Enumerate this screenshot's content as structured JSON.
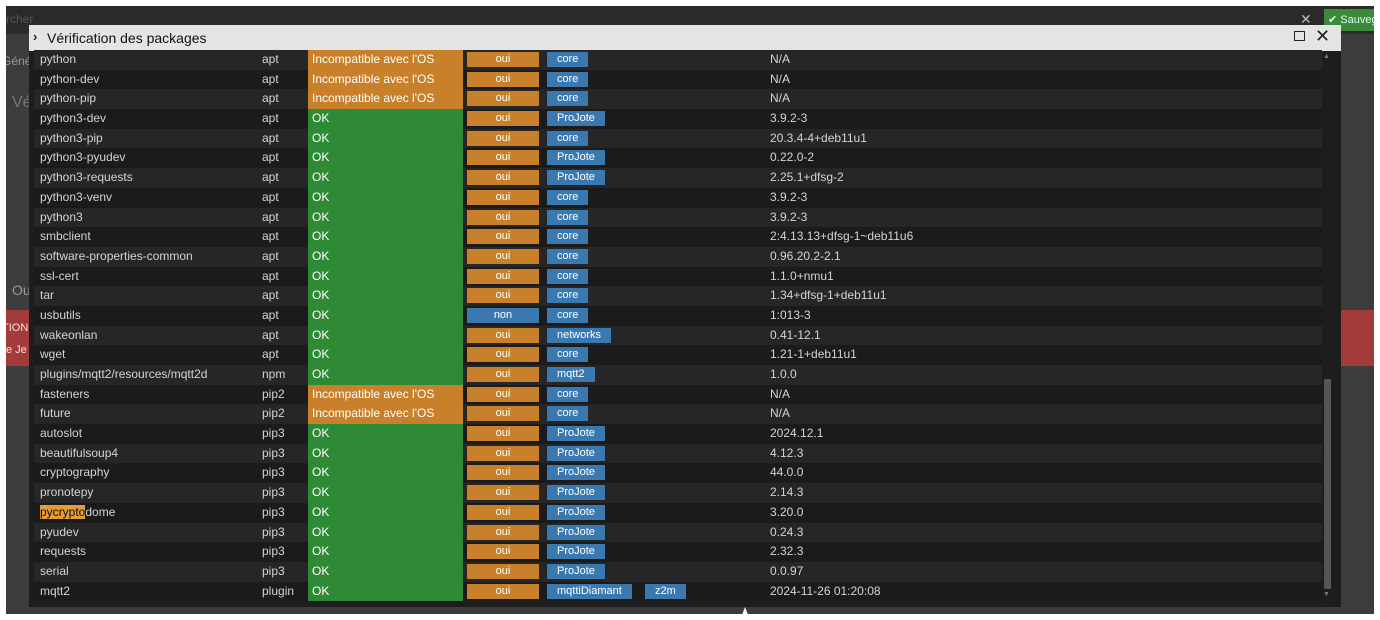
{
  "background": {
    "search_fragment": "rcher",
    "close_glyph": "✕",
    "save_label": "Sauvega",
    "genera": "Généra",
    "ve": "Vé",
    "ou": "Ou",
    "tion": "TION",
    "eje": "e Je"
  },
  "modal": {
    "title": "Vérification des packages",
    "chevron": "›",
    "close_glyph": "✕"
  },
  "packages": [
    {
      "name": "python",
      "type": "apt",
      "status": "Incompatible avec l'OS",
      "status_kind": "bad",
      "needed": "oui",
      "tags": [
        "core"
      ],
      "version": "N/A"
    },
    {
      "name": "python-dev",
      "type": "apt",
      "status": "Incompatible avec l'OS",
      "status_kind": "bad",
      "needed": "oui",
      "tags": [
        "core"
      ],
      "version": "N/A"
    },
    {
      "name": "python-pip",
      "type": "apt",
      "status": "Incompatible avec l'OS",
      "status_kind": "bad",
      "needed": "oui",
      "tags": [
        "core"
      ],
      "version": "N/A"
    },
    {
      "name": "python3-dev",
      "type": "apt",
      "status": "OK",
      "status_kind": "ok",
      "needed": "oui",
      "tags": [
        "ProJote"
      ],
      "version": "3.9.2-3"
    },
    {
      "name": "python3-pip",
      "type": "apt",
      "status": "OK",
      "status_kind": "ok",
      "needed": "oui",
      "tags": [
        "core"
      ],
      "version": "20.3.4-4+deb11u1"
    },
    {
      "name": "python3-pyudev",
      "type": "apt",
      "status": "OK",
      "status_kind": "ok",
      "needed": "oui",
      "tags": [
        "ProJote"
      ],
      "version": "0.22.0-2"
    },
    {
      "name": "python3-requests",
      "type": "apt",
      "status": "OK",
      "status_kind": "ok",
      "needed": "oui",
      "tags": [
        "ProJote"
      ],
      "version": "2.25.1+dfsg-2"
    },
    {
      "name": "python3-venv",
      "type": "apt",
      "status": "OK",
      "status_kind": "ok",
      "needed": "oui",
      "tags": [
        "core"
      ],
      "version": "3.9.2-3"
    },
    {
      "name": "python3",
      "type": "apt",
      "status": "OK",
      "status_kind": "ok",
      "needed": "oui",
      "tags": [
        "core"
      ],
      "version": "3.9.2-3"
    },
    {
      "name": "smbclient",
      "type": "apt",
      "status": "OK",
      "status_kind": "ok",
      "needed": "oui",
      "tags": [
        "core"
      ],
      "version": "2:4.13.13+dfsg-1~deb11u6"
    },
    {
      "name": "software-properties-common",
      "type": "apt",
      "status": "OK",
      "status_kind": "ok",
      "needed": "oui",
      "tags": [
        "core"
      ],
      "version": "0.96.20.2-2.1"
    },
    {
      "name": "ssl-cert",
      "type": "apt",
      "status": "OK",
      "status_kind": "ok",
      "needed": "oui",
      "tags": [
        "core"
      ],
      "version": "1.1.0+nmu1"
    },
    {
      "name": "tar",
      "type": "apt",
      "status": "OK",
      "status_kind": "ok",
      "needed": "oui",
      "tags": [
        "core"
      ],
      "version": "1.34+dfsg-1+deb11u1"
    },
    {
      "name": "usbutils",
      "type": "apt",
      "status": "OK",
      "status_kind": "ok",
      "needed": "non",
      "tags": [
        "core"
      ],
      "version": "1:013-3"
    },
    {
      "name": "wakeonlan",
      "type": "apt",
      "status": "OK",
      "status_kind": "ok",
      "needed": "oui",
      "tags": [
        "networks"
      ],
      "version": "0.41-12.1"
    },
    {
      "name": "wget",
      "type": "apt",
      "status": "OK",
      "status_kind": "ok",
      "needed": "oui",
      "tags": [
        "core"
      ],
      "version": "1.21-1+deb11u1"
    },
    {
      "name": "plugins/mqtt2/resources/mqtt2d",
      "type": "npm",
      "status": "OK",
      "status_kind": "ok",
      "needed": "oui",
      "tags": [
        "mqtt2"
      ],
      "version": "1.0.0"
    },
    {
      "name": "fasteners",
      "type": "pip2",
      "status": "Incompatible avec l'OS",
      "status_kind": "bad",
      "needed": "oui",
      "tags": [
        "core"
      ],
      "version": "N/A"
    },
    {
      "name": "future",
      "type": "pip2",
      "status": "Incompatible avec l'OS",
      "status_kind": "bad",
      "needed": "oui",
      "tags": [
        "core"
      ],
      "version": "N/A"
    },
    {
      "name": "autoslot",
      "type": "pip3",
      "status": "OK",
      "status_kind": "ok",
      "needed": "oui",
      "tags": [
        "ProJote"
      ],
      "version": "2024.12.1"
    },
    {
      "name": "beautifulsoup4",
      "type": "pip3",
      "status": "OK",
      "status_kind": "ok",
      "needed": "oui",
      "tags": [
        "ProJote"
      ],
      "version": "4.12.3"
    },
    {
      "name": "cryptography",
      "type": "pip3",
      "status": "OK",
      "status_kind": "ok",
      "needed": "oui",
      "tags": [
        "ProJote"
      ],
      "version": "44.0.0"
    },
    {
      "name": "pronotepy",
      "type": "pip3",
      "status": "OK",
      "status_kind": "ok",
      "needed": "oui",
      "tags": [
        "ProJote"
      ],
      "version": "2.14.3"
    },
    {
      "name": "pycryptodome",
      "name_highlight": "pycrypto",
      "name_rest": "dome",
      "type": "pip3",
      "status": "OK",
      "status_kind": "ok",
      "needed": "oui",
      "tags": [
        "ProJote"
      ],
      "version": "3.20.0"
    },
    {
      "name": "pyudev",
      "type": "pip3",
      "status": "OK",
      "status_kind": "ok",
      "needed": "oui",
      "tags": [
        "ProJote"
      ],
      "version": "0.24.3"
    },
    {
      "name": "requests",
      "type": "pip3",
      "status": "OK",
      "status_kind": "ok",
      "needed": "oui",
      "tags": [
        "ProJote"
      ],
      "version": "2.32.3"
    },
    {
      "name": "serial",
      "type": "pip3",
      "status": "OK",
      "status_kind": "ok",
      "needed": "oui",
      "tags": [
        "ProJote"
      ],
      "version": "0.0.97"
    },
    {
      "name": "mqtt2",
      "type": "plugin",
      "status": "OK",
      "status_kind": "ok",
      "needed": "oui",
      "tags": [
        "mqttiDiamant",
        "z2m"
      ],
      "version": "2024-11-26 01:20:08"
    }
  ],
  "colors": {
    "ok": "#2f8a36",
    "incompatible": "#c8812a",
    "oui": "#c8812a",
    "non": "#3a78b0",
    "tag": "#3a78b0",
    "highlight": "#e69a3a"
  }
}
